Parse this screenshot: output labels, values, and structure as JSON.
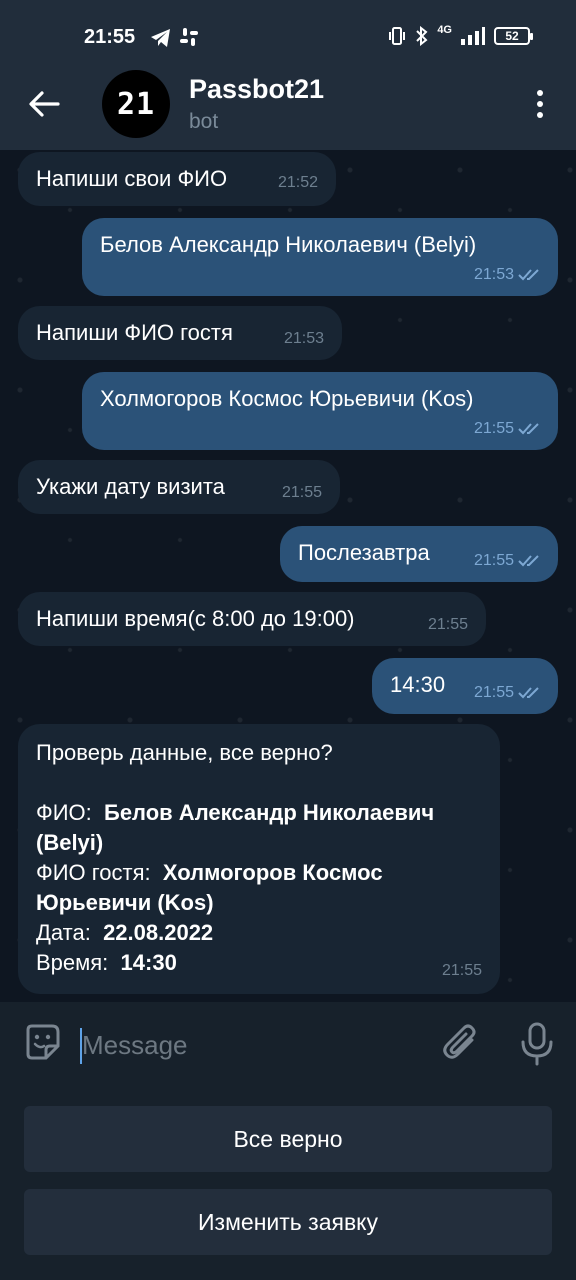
{
  "status_bar": {
    "time": "21:55",
    "battery": "52",
    "network": "4G"
  },
  "header": {
    "title": "Passbot21",
    "subtitle": "bot",
    "avatar_text": "21"
  },
  "messages": [
    {
      "dir": "in",
      "text": "Напиши свои ФИО",
      "time": "21:52"
    },
    {
      "dir": "out",
      "text": "Белов Александр Николаевич (Belyi)",
      "time": "21:53"
    },
    {
      "dir": "in",
      "text": "Напиши ФИО гостя",
      "time": "21:53"
    },
    {
      "dir": "out",
      "text": "Холмогоров Космос Юрьевичи (Kos)",
      "time": "21:55"
    },
    {
      "dir": "in",
      "text": "Укажи дату визита",
      "time": "21:55"
    },
    {
      "dir": "out",
      "text": "Послезавтра",
      "time": "21:55"
    },
    {
      "dir": "in",
      "text": "Напиши время(с 8:00 до 19:00)",
      "time": "21:55"
    },
    {
      "dir": "out",
      "text": "14:30",
      "time": "21:55"
    }
  ],
  "summary": {
    "question": "Проверь данные, все верно?",
    "fio_label": "ФИО:",
    "fio_value_1": "Белов Александр Николаевич",
    "fio_value_2": "(Belyi)",
    "guest_label": "ФИО гостя:",
    "guest_value_1": "Холмогоров Космос",
    "guest_value_2": "Юрьевичи (Kos)",
    "date_label": "Дата:",
    "date_value": "22.08.2022",
    "time_label": "Время:",
    "time_value": "14:30",
    "time": "21:55"
  },
  "input": {
    "placeholder": "Message"
  },
  "keyboard": {
    "confirm_label": "Все верно",
    "edit_label": "Изменить заявку"
  },
  "colors": {
    "header_bg": "#212d3b",
    "chat_bg": "#0e1621",
    "incoming_bubble": "#182533",
    "outgoing_bubble": "#2b5278",
    "read_check": "#7da8d3"
  }
}
